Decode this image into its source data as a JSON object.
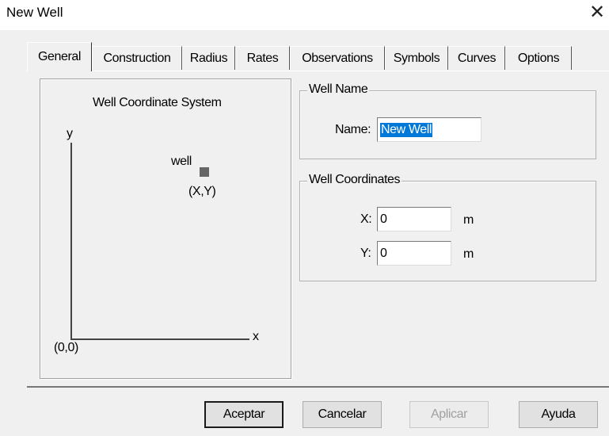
{
  "window": {
    "title": "New Well",
    "close_glyph": "✕"
  },
  "tabs": [
    {
      "label": "General",
      "active": true
    },
    {
      "label": "Construction"
    },
    {
      "label": "Radius"
    },
    {
      "label": "Rates"
    },
    {
      "label": "Observations"
    },
    {
      "label": "Symbols"
    },
    {
      "label": "Curves"
    },
    {
      "label": "Options"
    }
  ],
  "diagram": {
    "title": "Well Coordinate System",
    "y_label": "y",
    "x_label": "x",
    "origin_label": "(0,0)",
    "well_label": "well",
    "well_coord_label": "(X,Y)"
  },
  "well_name": {
    "group_label": "Well Name",
    "name_label": "Name:",
    "name_value": "New Well"
  },
  "well_coordinates": {
    "group_label": "Well Coordinates",
    "x_label": "X:",
    "x_value": "0",
    "y_label": "Y:",
    "y_value": "0",
    "unit": "m"
  },
  "buttons": {
    "ok": "Aceptar",
    "cancel": "Cancelar",
    "apply": "Aplicar",
    "help": "Ayuda"
  },
  "colors": {
    "selection": "#0078d7",
    "marker": "#666666"
  }
}
